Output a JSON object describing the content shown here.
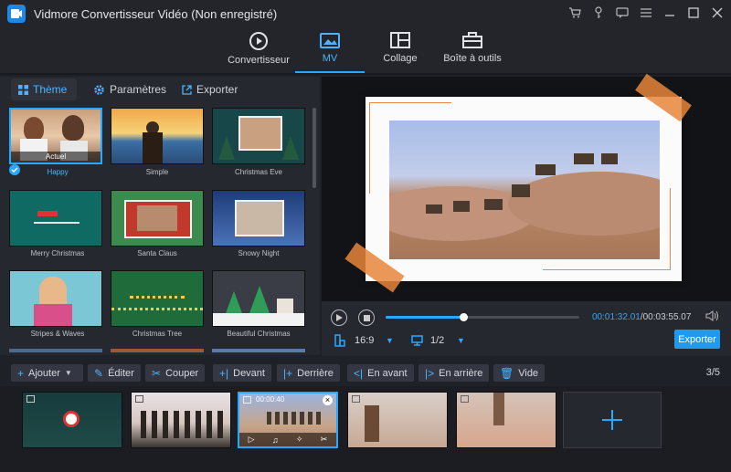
{
  "app": {
    "title": "Vidmore Convertisseur Vidéo (Non enregistré)"
  },
  "nav": {
    "items": [
      {
        "label": "Convertisseur"
      },
      {
        "label": "MV"
      },
      {
        "label": "Collage"
      },
      {
        "label": "Boîte à outils"
      }
    ]
  },
  "left_tabs": {
    "theme": "Thème",
    "params": "Paramètres",
    "export": "Exporter"
  },
  "themes": [
    {
      "label": "Happy",
      "badge": "Actuel"
    },
    {
      "label": "Simple"
    },
    {
      "label": "Christmas Eve"
    },
    {
      "label": "Merry Christmas"
    },
    {
      "label": "Santa Claus"
    },
    {
      "label": "Snowy Night"
    },
    {
      "label": "Stripes & Waves"
    },
    {
      "label": "Christmas Tree"
    },
    {
      "label": "Beautiful Christmas"
    }
  ],
  "playback": {
    "current": "00:01:32.01",
    "total": "/00:03:55.07",
    "ratio": "16:9",
    "page": "1/2",
    "export_label": "Exporter",
    "progress": 0.4
  },
  "toolbar": {
    "add": "Ajouter",
    "edit": "Éditer",
    "cut": "Couper",
    "front": "Devant",
    "back": "Derrière",
    "forward": "En avant",
    "backward": "En arrière",
    "empty": "Vide",
    "count": "3/5"
  },
  "clips": {
    "selected_duration": "00:00:40"
  },
  "colors": {
    "accent": "#29a8ff",
    "bg": "#1f2128"
  }
}
